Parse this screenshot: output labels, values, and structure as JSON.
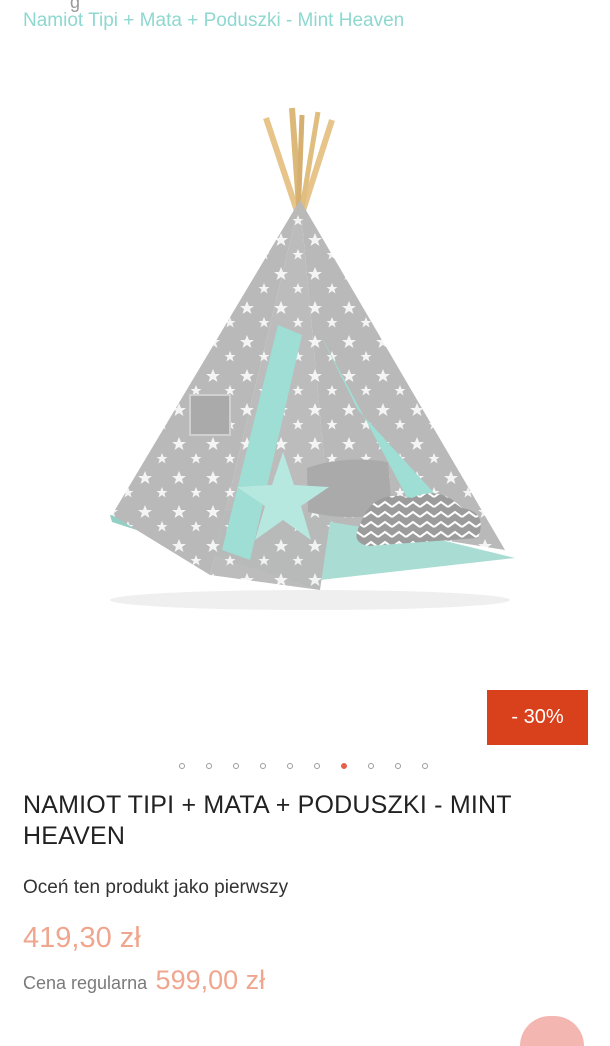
{
  "breadcrumb": {
    "current": "Namiot Tipi + Mata + Poduszki - Mint Heaven"
  },
  "product": {
    "discount_badge": "- 30%",
    "title": "NAMIOT TIPI + MATA + PODUSZKI - MINT HEAVEN",
    "rate_prompt": "Oceń ten produkt jako pierwszy",
    "price": "419,30 zł",
    "regular_label": "Cena regularna",
    "regular_price": "599,00 zł"
  },
  "gallery": {
    "slide_count": 10,
    "active_index": 6
  },
  "colors": {
    "accent_mint": "#8ed8d0",
    "badge_red": "#d9401c",
    "price_salmon": "#f0a68e"
  }
}
